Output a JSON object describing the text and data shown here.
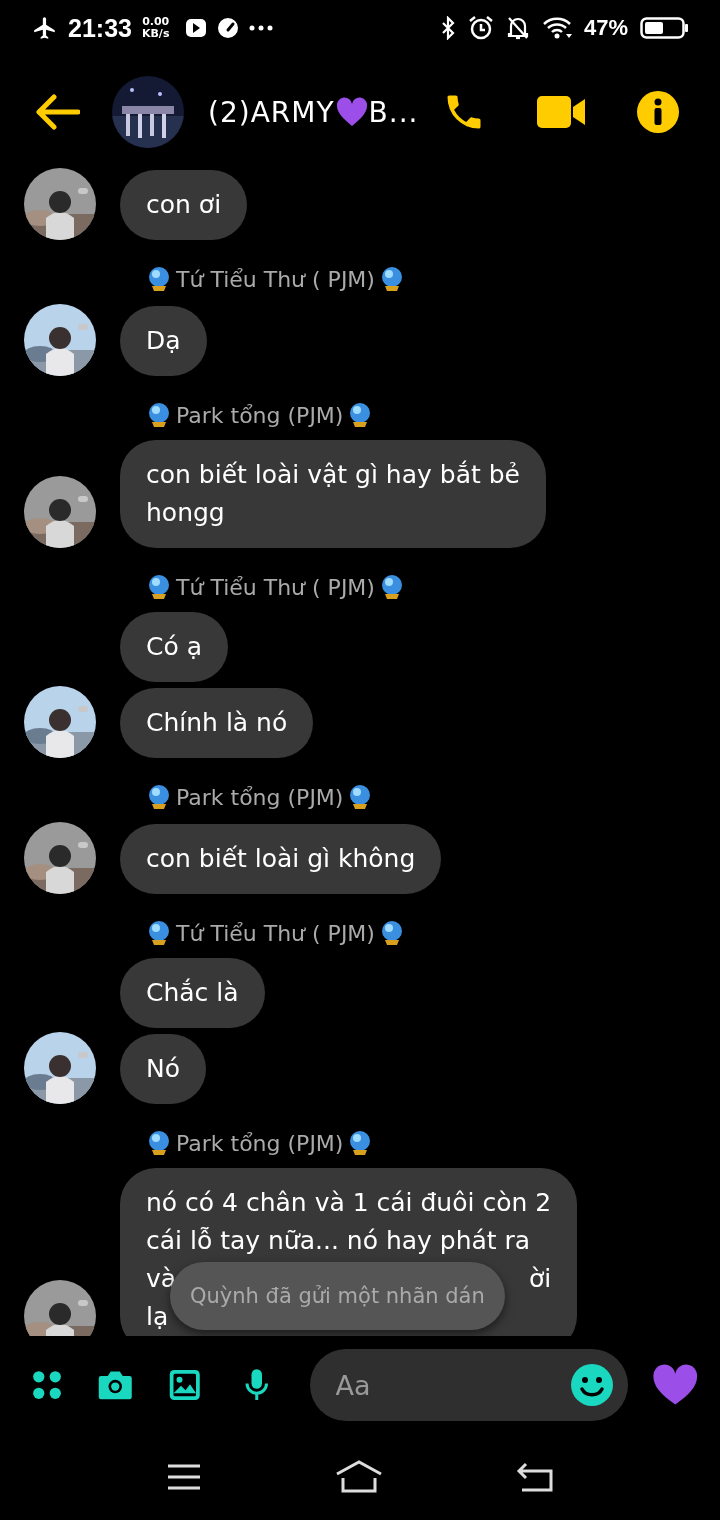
{
  "status_bar": {
    "time": "21:33",
    "speed_value": "0.00",
    "speed_unit": "KB/s",
    "battery": "47%"
  },
  "header": {
    "title_start": "(2)ARMY",
    "title_end": "B..."
  },
  "groups": [
    {
      "messages": [
        {
          "lines": [
            {
              "text": "con ơi"
            }
          ]
        }
      ]
    },
    {
      "sender": "Tứ Tiểu Thư ( PJM)",
      "messages": [
        {
          "lines": [
            {
              "text": "Dạ"
            }
          ]
        }
      ]
    },
    {
      "sender": "Park tổng (PJM)",
      "messages": [
        {
          "lines": [
            {
              "text": "con biết loài vật gì hay bắt bẻ"
            },
            {
              "text": "hongg"
            }
          ]
        }
      ]
    },
    {
      "sender": "Tứ Tiểu Thư ( PJM)",
      "messages": [
        {
          "lines": [
            {
              "text": "Có ạ"
            }
          ]
        },
        {
          "lines": [
            {
              "text": "Chính là nó"
            }
          ]
        }
      ]
    },
    {
      "sender": "Park tổng (PJM)",
      "messages": [
        {
          "lines": [
            {
              "text": "con biết loài gì không"
            }
          ]
        }
      ]
    },
    {
      "sender": "Tứ Tiểu Thư ( PJM)",
      "messages": [
        {
          "lines": [
            {
              "text": "Chắc là"
            }
          ]
        },
        {
          "lines": [
            {
              "text": "Nó"
            }
          ]
        }
      ]
    },
    {
      "sender": "Park tổng (PJM)",
      "messages": [
        {
          "lines": [
            {
              "text": "nó có 4 chân và 1 cái đuôi còn 2"
            },
            {
              "text": "cái lỗ tay nữa... nó hay phát ra"
            },
            {
              "text": "và",
              "end": "ời"
            },
            {
              "text": "lạ"
            }
          ]
        }
      ]
    }
  ],
  "toast": "Quỳnh đã gửi một nhãn dán",
  "composer": {
    "placeholder": "Aa"
  }
}
